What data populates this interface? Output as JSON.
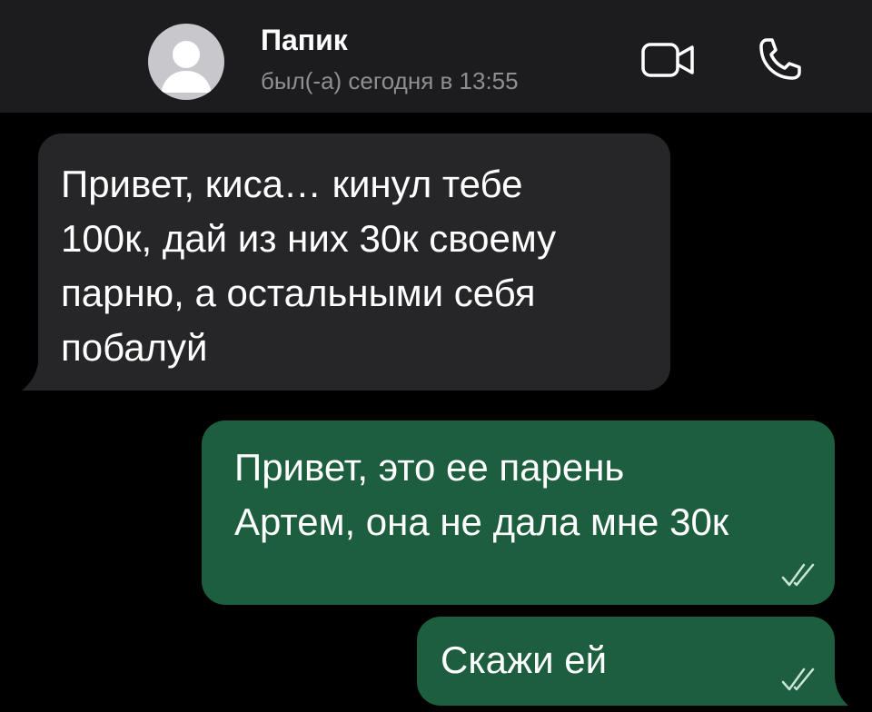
{
  "header": {
    "contact_name": "Папик",
    "status": "был(-а) сегодня в 13:55",
    "avatar_icon": "person-placeholder-icon",
    "video_icon": "video-camera-icon",
    "call_icon": "phone-icon"
  },
  "messages": [
    {
      "direction": "incoming",
      "lines": [
        "Привет, киса… кинул  тебе",
        "100к, дай из них 30к своему",
        "парню, а остальными себя",
        "побалуй"
      ]
    },
    {
      "direction": "outgoing",
      "lines": [
        "Привет, это ее парень",
        "Артем, она не дала мне 30к"
      ],
      "status_icon": "double-check-icon"
    },
    {
      "direction": "outgoing",
      "lines": [
        "Скажи ей"
      ],
      "status_icon": "double-check-icon"
    }
  ],
  "colors": {
    "background": "#000000",
    "header": "#1c1c1e",
    "incoming_bubble": "#262628",
    "outgoing_bubble": "#1d5e3f",
    "secondary_text": "#8e8e93"
  }
}
